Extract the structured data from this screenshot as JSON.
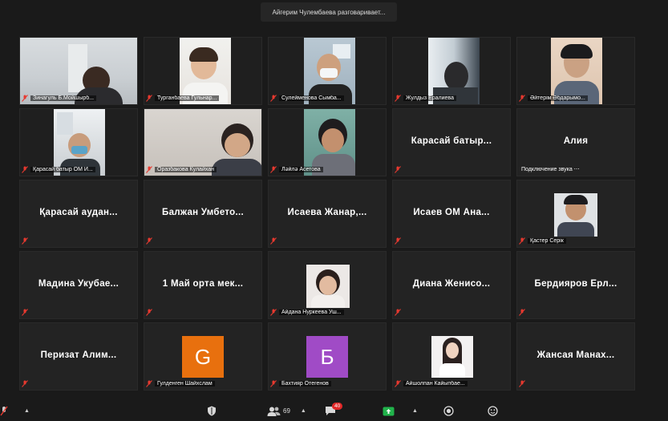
{
  "speaking_banner": "Айгерим Чулембаева разговаривает...",
  "colors": {
    "muted_mic": "#e8392f",
    "tile_bg": "#232323",
    "avatar_g": "#e8700e",
    "avatar_b": "#a04bc6",
    "share_green": "#21b34b"
  },
  "tiles": [
    {
      "name": "Зинагуль Б.Мойшырб...",
      "kind": "video"
    },
    {
      "name": "Турганбаева Гульнар...",
      "kind": "video"
    },
    {
      "name": "Сулейменова Сымба...",
      "kind": "video"
    },
    {
      "name": "Жулдыз Ералиева",
      "kind": "video"
    },
    {
      "name": "Әйтерім Әбдарымо...",
      "kind": "video"
    },
    {
      "name": "Қарасай батыр ОМ И...",
      "kind": "video"
    },
    {
      "name": "Оразбакова Кулайхан",
      "kind": "video"
    },
    {
      "name": "Ләйлә Асетова",
      "kind": "video"
    },
    {
      "center": "Карасай батыр...",
      "kind": "name"
    },
    {
      "center": "Алия",
      "sub": "Подключение звука ⋯",
      "kind": "name"
    },
    {
      "center": "Қарасай аудан...",
      "kind": "name"
    },
    {
      "center": "Балжан Умбето...",
      "kind": "name"
    },
    {
      "center": "Исаева Жанар,...",
      "kind": "name"
    },
    {
      "center": "Исаев ОМ Ана...",
      "kind": "name"
    },
    {
      "name": "Қастер Серік",
      "kind": "photo"
    },
    {
      "center": "Мадина Укубае...",
      "kind": "name"
    },
    {
      "center": "1 Май орта мек...",
      "kind": "name"
    },
    {
      "name": "Айдана Нуркеева Уш...",
      "kind": "photo"
    },
    {
      "center": "Диана Женисо...",
      "kind": "name"
    },
    {
      "center": "Бердияров Ерл...",
      "kind": "name"
    },
    {
      "center": "Перизат Алим...",
      "kind": "name"
    },
    {
      "name": "Гулденген Шайхслам",
      "avatar": "G",
      "kind": "avatar"
    },
    {
      "name": "Бахтияр Отегенов",
      "avatar": "Б",
      "kind": "avatar"
    },
    {
      "name": "Айшолпан Кайыпбае...",
      "kind": "photo"
    },
    {
      "center": "Жансая Манах...",
      "kind": "name"
    }
  ],
  "toolbar": {
    "participants_count": "69",
    "chat_badge": "40"
  },
  "icons": [
    "mic-muted-icon",
    "security-shield-icon",
    "participants-icon",
    "chat-icon",
    "share-screen-icon",
    "record-icon",
    "reactions-icon",
    "caret-up-icon"
  ]
}
